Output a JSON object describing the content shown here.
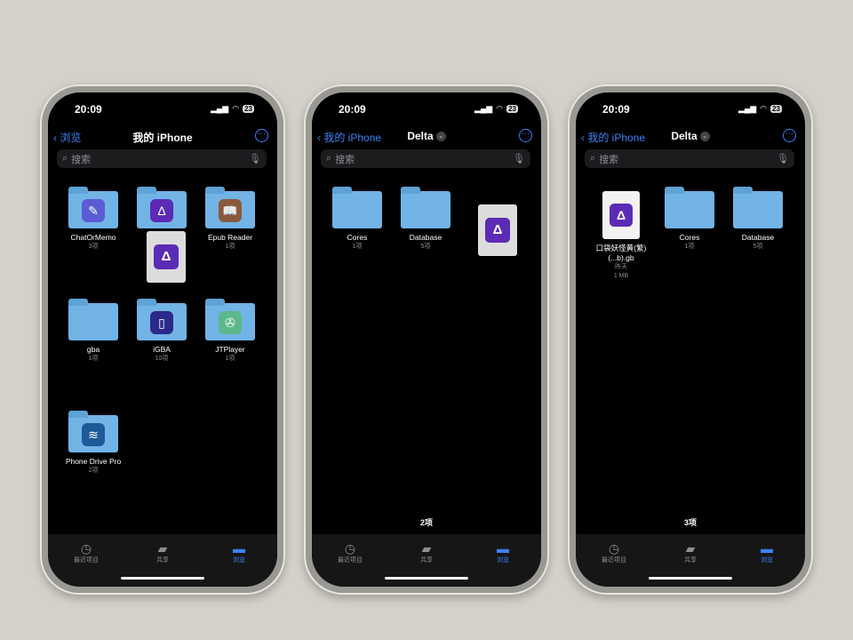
{
  "status": {
    "time": "20:09",
    "battery": "23"
  },
  "tabs": [
    {
      "label": "最近项目",
      "icon": "clock-icon"
    },
    {
      "label": "共享",
      "icon": "shared-folder-icon"
    },
    {
      "label": "浏览",
      "icon": "folder-icon"
    }
  ],
  "search_placeholder": "搜索",
  "accent": "#3b82f6",
  "phones": [
    {
      "back": "浏览",
      "title": "我的 iPhone",
      "dropdown": false,
      "count": "",
      "active_tab": 2,
      "items": [
        {
          "name": "ChatOrMemo",
          "sub": "3项",
          "app": "ChatOrMemo",
          "color": "#5b5bd6",
          "glyph": "✎"
        },
        {
          "name": "Delta",
          "sub": "",
          "app": "Delta",
          "color": "#5b2bb5",
          "glyph": "Δ"
        },
        {
          "name": "Epub Reader",
          "sub": "1项",
          "app": "Epub Reader",
          "color": "#8a5a3c",
          "glyph": "📖"
        },
        {
          "name": "gba",
          "sub": "1项"
        },
        {
          "name": "iGBA",
          "sub": "10项",
          "app": "iGBA",
          "color": "#2a2a8a",
          "glyph": "▯"
        },
        {
          "name": "JTPlayer",
          "sub": "1项",
          "app": "JTPlayer",
          "color": "#5cb88a",
          "glyph": "✇"
        },
        {
          "name": "Phone Drive Pro",
          "sub": "2项",
          "app": "Phone Drive",
          "color": "#1e5a9a",
          "glyph": "≋"
        }
      ],
      "dragging": "Delta game file"
    },
    {
      "back": "我的 iPhone",
      "title": "Delta",
      "dropdown": true,
      "count": "2项",
      "active_tab": 2,
      "items": [
        {
          "name": "Cores",
          "sub": "1项"
        },
        {
          "name": "Database",
          "sub": "5项"
        }
      ],
      "dragging": "Delta game file"
    },
    {
      "back": "我的 iPhone",
      "title": "Delta",
      "dropdown": true,
      "count": "3项",
      "active_tab": 2,
      "items": [
        {
          "name": "口袋妖怪黄(繁) (...b).gb",
          "sub": "昨天",
          "size": "1 MB",
          "file": true
        },
        {
          "name": "Cores",
          "sub": "1项"
        },
        {
          "name": "Database",
          "sub": "5项"
        }
      ]
    }
  ]
}
